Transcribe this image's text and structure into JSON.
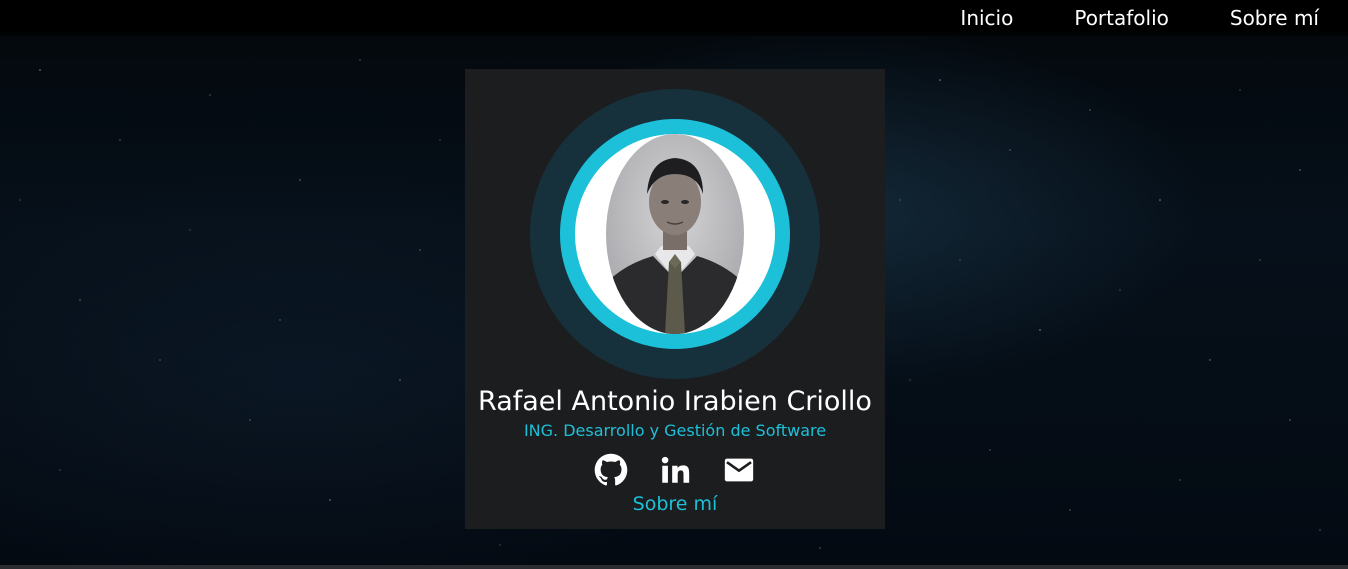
{
  "nav": {
    "items": [
      {
        "label": "Inicio"
      },
      {
        "label": "Portafolio"
      },
      {
        "label": "Sobre mí"
      }
    ]
  },
  "profile": {
    "name": "Rafael Antonio Irabien Criollo",
    "title": "ING. Desarrollo y Gestión de Software",
    "about_link": "Sobre mí",
    "socials": [
      {
        "icon": "github-icon"
      },
      {
        "icon": "linkedin-icon"
      },
      {
        "icon": "mail-icon"
      }
    ]
  },
  "colors": {
    "accent": "#1cc0d8",
    "card_bg": "#1c1d1f",
    "ring_outer": "#16313b"
  }
}
